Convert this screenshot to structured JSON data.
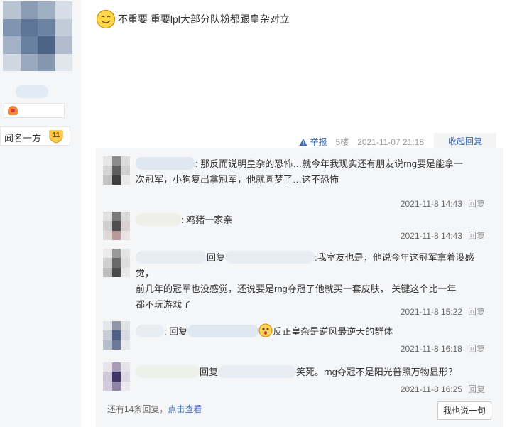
{
  "user": {
    "title_label": "闻名一方",
    "title_level": "11"
  },
  "post": {
    "text": "不重要 重要lpl大部分队粉都跟皇杂对立",
    "report_label": "举报",
    "floor": "5楼",
    "time": "2021-11-07 21:18",
    "collapse_label": "收起回复"
  },
  "replies": [
    {
      "text_line1": ": 那反而说明皇杂的恐怖…就今年我现实还有朋友说rng要是能拿一",
      "text_line2": "次冠军，小狗复出拿冠军，他就圆梦了…这不恐怖",
      "time": "2021-11-8 14:43",
      "reply_label": "回复"
    },
    {
      "text_line1": ": 鸡猪一家亲",
      "time": "2021-11-8 14:43",
      "reply_label": "回复"
    },
    {
      "prefix": "回复",
      "text_line1": ":我室友也是，他说今年这冠军拿着没感觉，",
      "text_line2": "前几年的冠军也没感觉，还说要是rng夺冠了他就买一套皮肤， 关键这个比一年",
      "text_line3": "都不玩游戏了",
      "time": "2021-11-8 15:22",
      "reply_label": "回复"
    },
    {
      "prefix": ": 回复",
      "text_line1": "反正皇杂是逆风最逆天的群体",
      "time": "2021-11-8 16:18",
      "reply_label": "回复"
    },
    {
      "prefix": "回复",
      "text_line1": "笑死。rng夺冠不是阳光普照万物显形？",
      "time": "2021-11-8 16:25",
      "reply_label": "回复"
    }
  ],
  "footer": {
    "more_prefix": "还有14条回复，",
    "more_link": "点击查看",
    "say_button": "我也说一句"
  },
  "colors": {
    "link_blue": "#3f6bb0",
    "reply_bg": "#f5f6f8",
    "meta_gray": "#999999"
  },
  "icons": {
    "post_emoji": "smiley-emoji-icon",
    "reply_emoji": "surprised-emoji-icon",
    "report": "warning-icon",
    "level": "level-flame-icon",
    "title_badge": "shield-badge-icon"
  }
}
